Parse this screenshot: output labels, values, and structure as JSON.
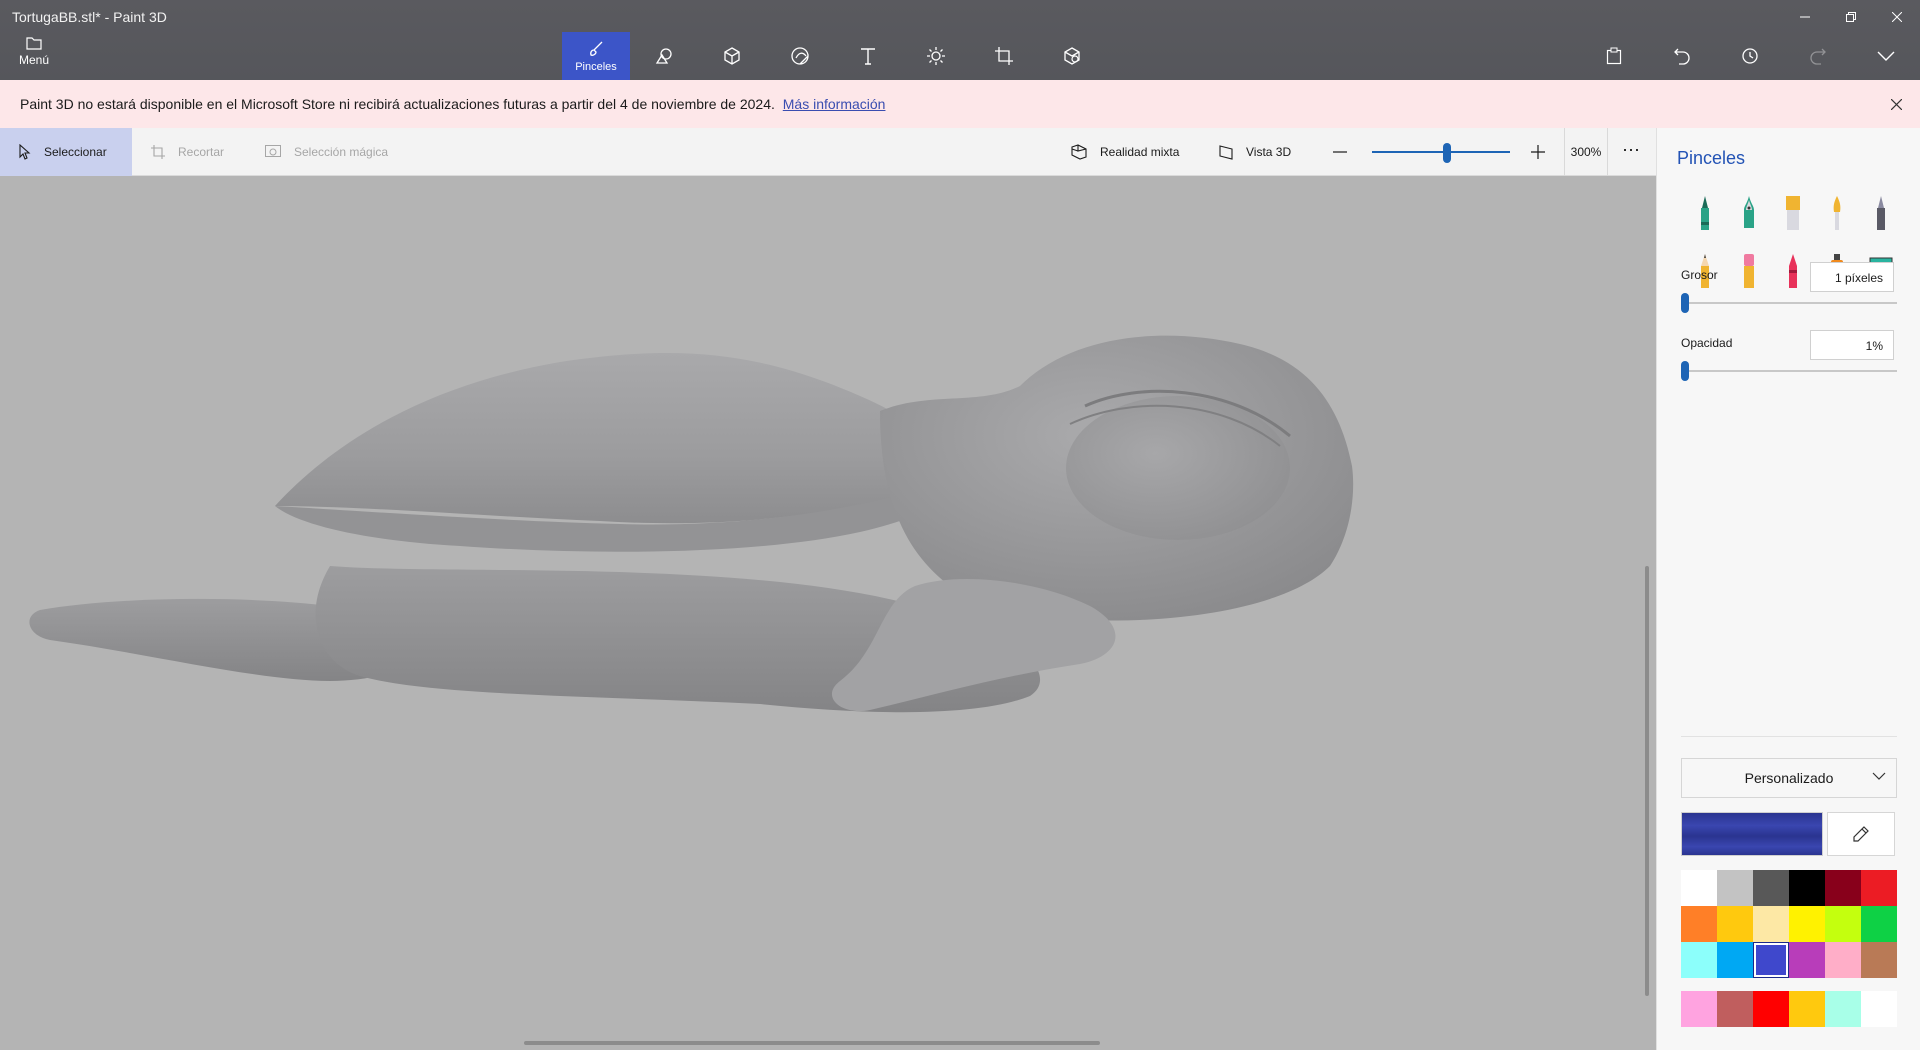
{
  "window": {
    "title": "TortugaBB.stl* - Paint 3D"
  },
  "menu": {
    "label": "Menú"
  },
  "tools": [
    {
      "label": "Pinceles",
      "icon": "brush-icon",
      "active": true
    },
    {
      "label": "",
      "icon": "2d-shapes-icon"
    },
    {
      "label": "",
      "icon": "3d-shapes-icon"
    },
    {
      "label": "",
      "icon": "stickers-icon"
    },
    {
      "label": "",
      "icon": "text-icon"
    },
    {
      "label": "",
      "icon": "effects-icon"
    },
    {
      "label": "",
      "icon": "canvas-icon"
    },
    {
      "label": "",
      "icon": "3d-library-icon"
    }
  ],
  "notice": {
    "text": "Paint 3D no estará disponible en el Microsoft Store ni recibirá actualizaciones futuras a partir del 4 de noviembre de 2024.",
    "link": "Más información"
  },
  "subbar": {
    "select": "Seleccionar",
    "crop": "Recortar",
    "magic_select": "Selección mágica",
    "mixed_reality": "Realidad mixta",
    "view3d": "Vista 3D",
    "zoom": "300%",
    "zoom_level": 0.62
  },
  "panel": {
    "title": "Pinceles",
    "brushes": [
      {
        "name": "marker",
        "color": "#2aa387"
      },
      {
        "name": "calligraphy-pen",
        "color": "#2aa387"
      },
      {
        "name": "oil-brush",
        "color": "#f0b431"
      },
      {
        "name": "watercolor",
        "color": "#f0b431"
      },
      {
        "name": "pixel-pen",
        "color": "#5a5a66"
      },
      {
        "name": "pencil",
        "color": "#f0b431"
      },
      {
        "name": "eraser",
        "color": "#f07aa0"
      },
      {
        "name": "crayon",
        "color": "#e8325a"
      },
      {
        "name": "spray-can",
        "color": "#f08a1e"
      },
      {
        "name": "fill",
        "color": "#2ab4a0"
      }
    ],
    "thickness": {
      "label": "Grosor",
      "value": "1 píxeles"
    },
    "opacity": {
      "label": "Opacidad",
      "value": "1%"
    },
    "palette_mode": "Personalizado",
    "current_color": "#2a3490",
    "colors": [
      "#ffffff",
      "#c3c3c3",
      "#585858",
      "#000000",
      "#88001b",
      "#ec1c24",
      "#ff7f27",
      "#ffc90e",
      "#fde8a5",
      "#fff200",
      "#c4ff0e",
      "#0ed145",
      "#8cfffb",
      "#00a8f3",
      "#3f48cc",
      "#b83dba",
      "#ffaec8",
      "#b97a56"
    ],
    "selected_color_index": 14,
    "custom_colors": [
      "#ffa3e0",
      "#c05e5e",
      "#ff0000",
      "#ffc90e",
      "#a8ffe8",
      "#ffffff"
    ]
  }
}
